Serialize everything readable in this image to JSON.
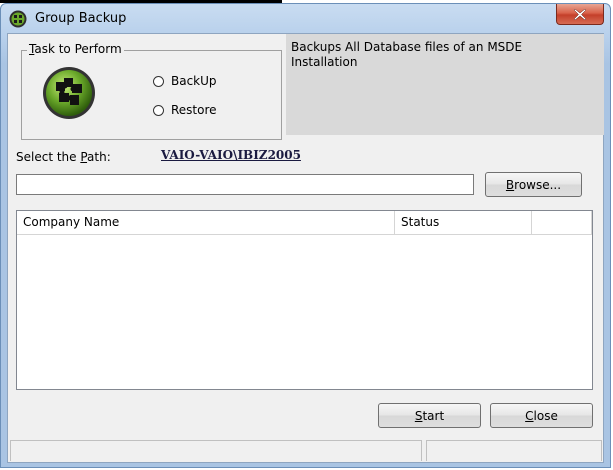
{
  "window": {
    "title": "Group Backup"
  },
  "task_group": {
    "label_prefix": "",
    "label_mnemonic": "T",
    "label_rest": "ask to Perform",
    "options": [
      {
        "label": "BackUp",
        "selected": false
      },
      {
        "label": "Restore",
        "selected": false
      }
    ]
  },
  "info": {
    "description": "Backups All Database files of an MSDE Installation"
  },
  "path": {
    "label_prefix": "Select the ",
    "label_mnemonic": "P",
    "label_rest": "ath:",
    "server": "VAIO-VAIO\\IBIZ2005",
    "input_value": ""
  },
  "browse_button": {
    "mnemonic": "B",
    "rest": "rowse..."
  },
  "table": {
    "columns": [
      "Company Name",
      "Status",
      ""
    ],
    "rows": []
  },
  "actions": {
    "start": {
      "mnemonic": "S",
      "rest": "tart"
    },
    "close": {
      "mnemonic": "C",
      "rest": "lose"
    }
  },
  "colors": {
    "title_bar": "#b9d1ec",
    "close_button": "#c4402a",
    "info_panel": "#d9d9d9",
    "logo_green": "#6aa82a"
  },
  "icons": {
    "app": "puzzle-logo-icon",
    "close": "close-icon",
    "logo": "puzzle-logo-icon"
  }
}
